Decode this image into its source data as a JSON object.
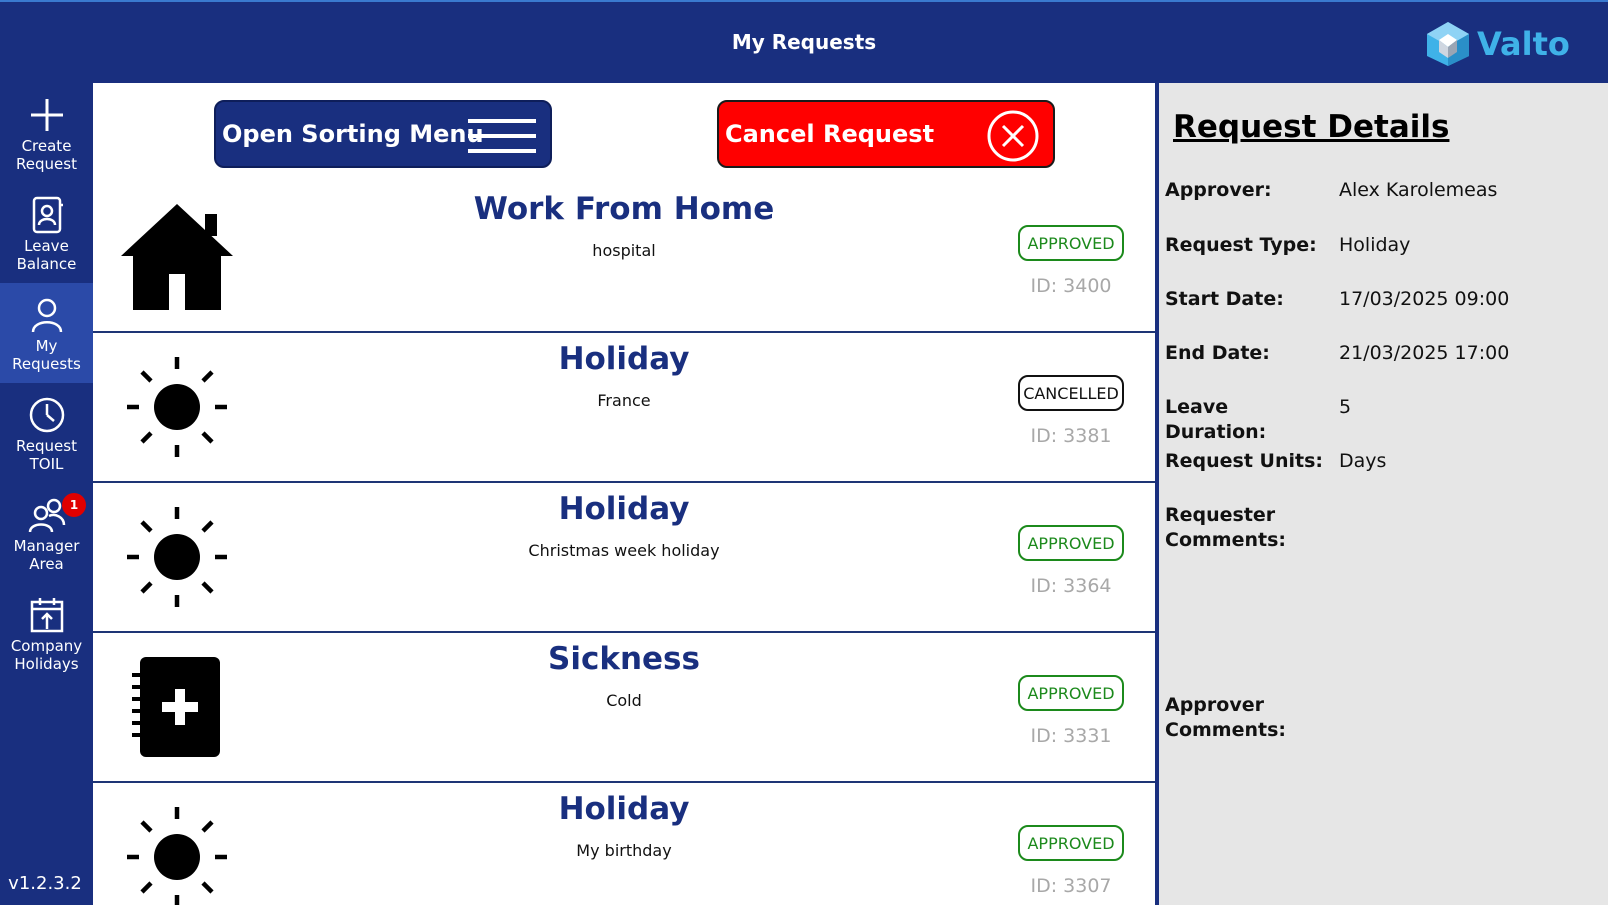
{
  "header": {
    "title": "My Requests",
    "logo_text": "Valto"
  },
  "sidebar": {
    "items": [
      {
        "label_line1": "Create",
        "label_line2": "Request"
      },
      {
        "label_line1": "Leave",
        "label_line2": "Balance"
      },
      {
        "label_line1": "My",
        "label_line2": "Requests"
      },
      {
        "label_line1": "Request",
        "label_line2": "TOIL"
      },
      {
        "label_line1": "Manager",
        "label_line2": "Area",
        "badge": "1"
      },
      {
        "label_line1": "Company",
        "label_line2": "Holidays"
      }
    ],
    "active_index": 2,
    "version": "v1.2.3.2"
  },
  "toolbar": {
    "sort_label": "Open Sorting Menu",
    "cancel_label": "Cancel Request"
  },
  "requests": [
    {
      "title": "Work From Home",
      "subtitle": "hospital",
      "status": "APPROVED",
      "id": "ID: 3400",
      "icon": "house-icon"
    },
    {
      "title": "Holiday",
      "subtitle": "France",
      "status": "CANCELLED",
      "id": "ID: 3381",
      "icon": "sun-icon"
    },
    {
      "title": "Holiday",
      "subtitle": "Christmas week holiday",
      "status": "APPROVED",
      "id": "ID: 3364",
      "icon": "sun-icon"
    },
    {
      "title": "Sickness",
      "subtitle": "Cold",
      "status": "APPROVED",
      "id": "ID: 3331",
      "icon": "medical-notebook-icon"
    },
    {
      "title": "Holiday",
      "subtitle": "My birthday",
      "status": "APPROVED",
      "id": "ID: 3307",
      "icon": "sun-icon"
    }
  ],
  "details": {
    "title": "Request Details",
    "approver_label": "Approver:",
    "approver": "Alex Karolemeas",
    "type_label": "Request Type:",
    "type": "Holiday",
    "start_label": "Start Date:",
    "start": "17/03/2025 09:00",
    "end_label": "End Date:",
    "end": "21/03/2025 17:00",
    "duration_label": "Leave Duration:",
    "duration": "5",
    "units_label": "Request Units:",
    "units": "Days",
    "requester_comments_line1": "Requester",
    "requester_comments_line2": "Comments:",
    "approver_comments_line1": "Approver",
    "approver_comments_line2": "Comments:"
  },
  "colors": {
    "brand": "#192f7f",
    "accent": "#3fb2e8",
    "approved": "#1c8a1c",
    "danger": "#ff0000"
  }
}
